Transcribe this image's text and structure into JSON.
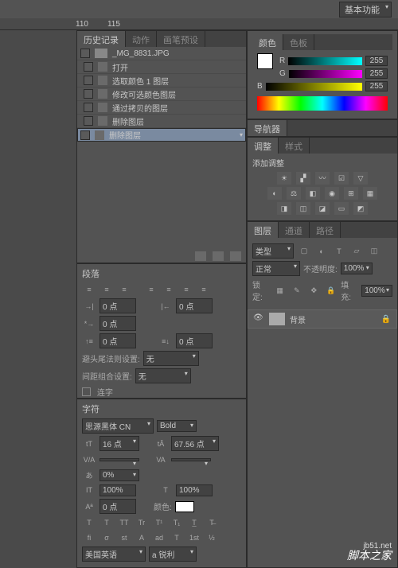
{
  "topDropdown": "基本功能",
  "ruler": {
    "t1": "110",
    "t2": "115"
  },
  "mid": {
    "historyTabs": [
      "历史记录",
      "动作",
      "画笔预设"
    ],
    "root": "_MG_8831.JPG",
    "items": [
      "打开",
      "选取颜色 1 图层",
      "修改可选颜色图层",
      "通过拷贝的图层",
      "删除图层",
      "删除图层"
    ],
    "paraTitle": "段落",
    "pt0": "0 点",
    "row1": {
      "l": "避头尾法则设置:",
      "v": "无"
    },
    "row2": {
      "l": "间距组合设置:",
      "v": "无"
    },
    "ligature": "连字",
    "charTitle": "字符",
    "font": "思源黑体 CN",
    "weight": "Bold",
    "size": "16 点",
    "leading": "67.56 点",
    "pct0": "0%",
    "pct100": "100%",
    "colorLbl": "颜色:",
    "lang": "美国英语",
    "aa": "a 锐利"
  },
  "right": {
    "colorTabs": [
      "颜色",
      "色板"
    ],
    "r": "R",
    "g": "G",
    "b": "B",
    "val255": "255",
    "navTab": "导航器",
    "adjTabs": [
      "调整",
      "样式"
    ],
    "adjTitle": "添加调整",
    "layerTabs": [
      "图层",
      "通道",
      "路径"
    ],
    "kind": "类型",
    "blend": "正常",
    "opacLbl": "不透明度:",
    "fillLbl": "填充:",
    "pct100": "100%",
    "lockLbl": "锁定:",
    "layerName": "背景"
  },
  "watermark": "脚本之家",
  "watermarkUrl": "jb51.net"
}
